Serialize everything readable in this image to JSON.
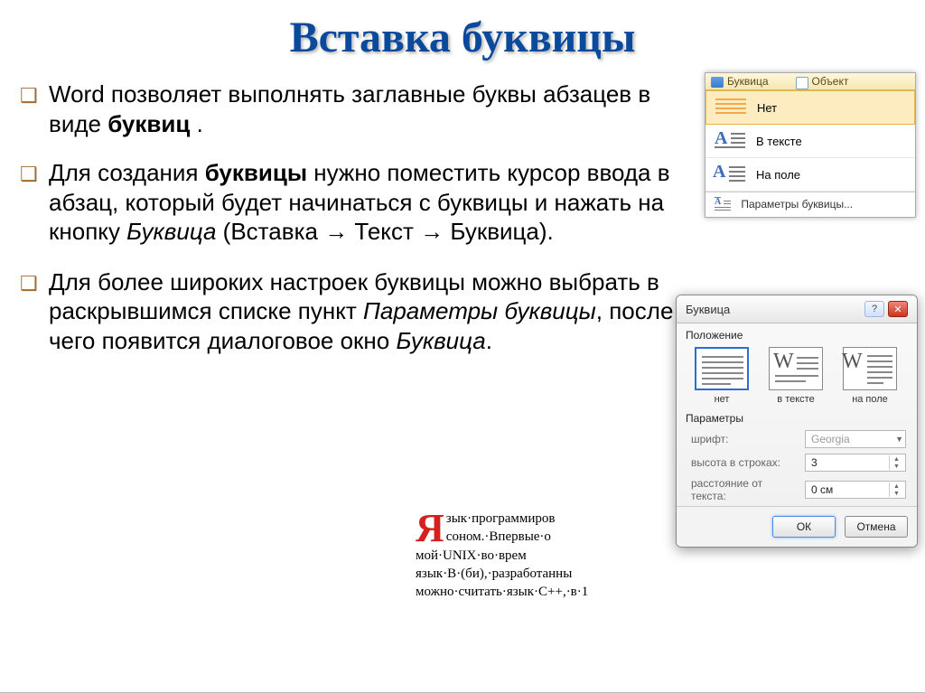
{
  "title": "Вставка буквицы",
  "bullets": {
    "p1_pre": "Word позволяет выполнять заглавные буквы абзацев в виде ",
    "p1_bold": "буквиц",
    "p1_post": " .",
    "p2_pre": "Для создания ",
    "p2_bold": "буквицы",
    "p2_mid": " нужно поместить курсор ввода в абзац, который будет начинаться с буквицы и нажать на кнопку ",
    "p2_italic": "Буквица",
    "p2_paren_open": " (Вставка ",
    "p2_arrow": "→",
    "p2_seg2": " Текст ",
    "p2_seg3": " Буквица).",
    "p3_pre": "Для более широких настроек буквицы можно выбрать в раскрывшимся списке пункт ",
    "p3_i1": "Параметры буквицы",
    "p3_mid": ", после чего появится диалоговое окно ",
    "p3_i2": "Буквица",
    "p3_end": "."
  },
  "ribbon": {
    "header_btn": "Буквица",
    "header_obj": "Объект",
    "items": {
      "none": "Нет",
      "intext": "В тексте",
      "inmargin": "На поле",
      "params": "Параметры буквицы..."
    }
  },
  "dialog": {
    "title": "Буквица",
    "section_position": "Положение",
    "opts": {
      "none": "нет",
      "intext": "в тексте",
      "inmargin": "на поле"
    },
    "section_params": "Параметры",
    "labels": {
      "font": "шрифт:",
      "height": "высота в строках:",
      "distance": "расстояние от текста:"
    },
    "values": {
      "font": "Georgia",
      "height": "3",
      "distance": "0 см"
    },
    "buttons": {
      "ok": "ОК",
      "cancel": "Отмена"
    },
    "help": "?",
    "close": "✕"
  },
  "example": {
    "dropcap": "Я",
    "line_frag": "зык·программиров\nсоном.·Впервые·о\nмой·UNIX·во·врем\nязык·В·(би),·разработанны\nможно·считать·язык·С++,·в·1"
  }
}
